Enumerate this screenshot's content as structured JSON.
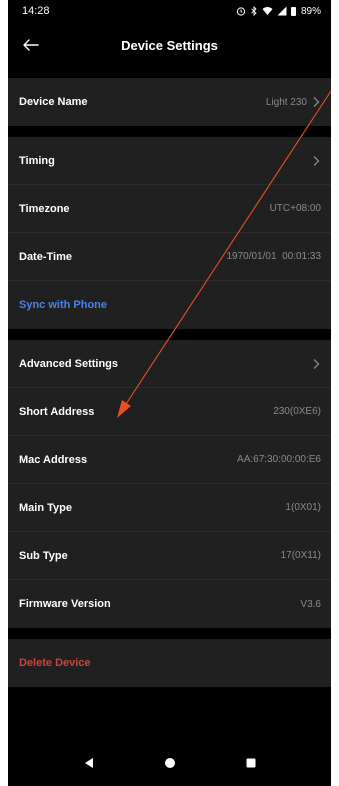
{
  "status_bar": {
    "time": "14:28",
    "battery": "89%",
    "icons": [
      "alarm-icon",
      "bluetooth-icon",
      "wifi-icon",
      "signal-icon",
      "battery-icon"
    ]
  },
  "header": {
    "title": "Device Settings",
    "back_icon": "arrow-left-icon"
  },
  "sections": {
    "device": {
      "name_label": "Device Name",
      "name_value": "Light 230"
    },
    "time": {
      "timing_label": "Timing",
      "timezone_label": "Timezone",
      "timezone_value": "UTC+08:00",
      "datetime_label": "Date-Time",
      "datetime_value": "1970/01/01  00:01:33",
      "sync_label": "Sync with Phone"
    },
    "advanced": {
      "advanced_label": "Advanced Settings",
      "short_address_label": "Short Address",
      "short_address_value": "230(0XE6)",
      "mac_label": "Mac Address",
      "mac_value": "AA:67:30:00:00:E6",
      "main_type_label": "Main Type",
      "main_type_value": "1(0X01)",
      "sub_type_label": "Sub Type",
      "sub_type_value": "17(0X11)",
      "firmware_label": "Firmware Version",
      "firmware_value": "V3.6"
    },
    "danger": {
      "delete_label": "Delete Device"
    }
  },
  "nav_bar": {
    "icons": [
      "back-triangle-icon",
      "home-circle-icon",
      "recents-square-icon"
    ]
  },
  "colors": {
    "background": "#000000",
    "section": "#202020",
    "link": "#4a82e8",
    "danger": "#c7463b",
    "annotation_arrow": "#e8501c"
  }
}
